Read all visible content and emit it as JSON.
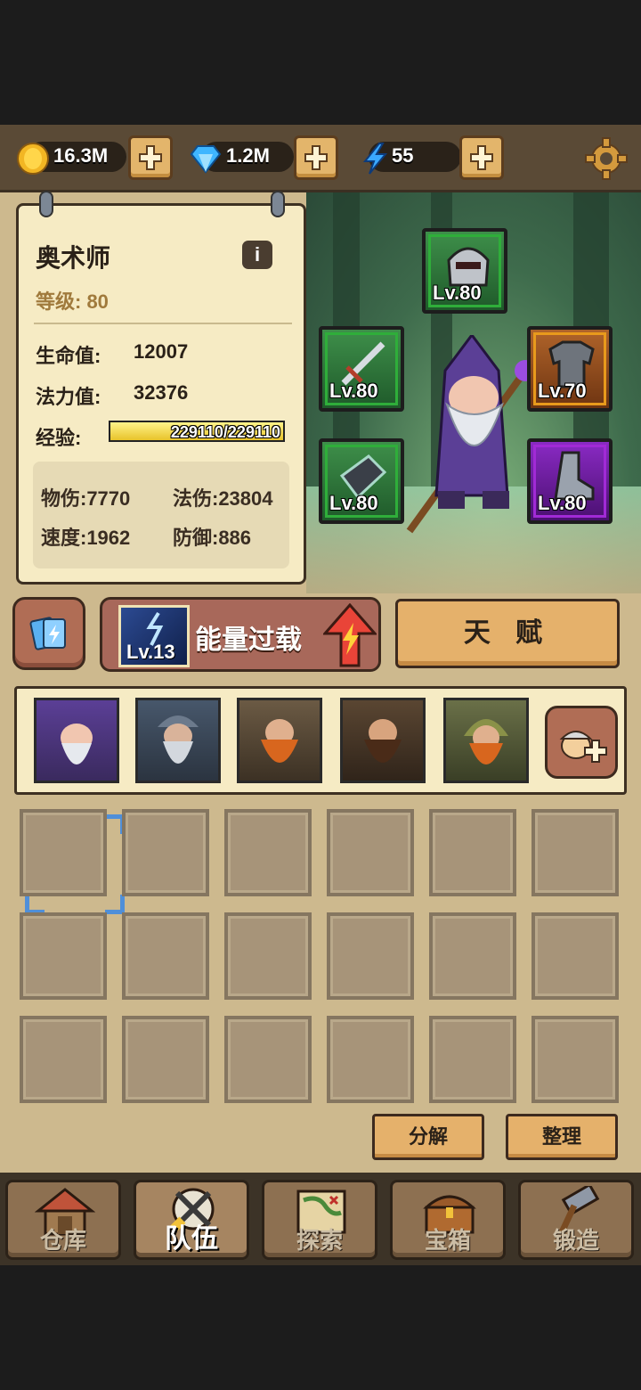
{
  "currencies": {
    "gold": "16.3M",
    "gems": "1.2M",
    "energy": "55"
  },
  "hero": {
    "name": "奥术师",
    "level_text": "等级: 80",
    "hp_label": "生命值:",
    "hp_value": "12007",
    "mp_label": "法力值:",
    "mp_value": "32376",
    "exp_label": "经验:",
    "exp_text": "229110/229110",
    "exp_fraction": 1.0,
    "phys_atk": "物伤:7770",
    "mag_atk": "法伤:23804",
    "speed": "速度:1962",
    "defense": "防御:886"
  },
  "equipment": {
    "helmet": "Lv.80",
    "weapon": "Lv.80",
    "armor": "Lv.70",
    "bracer": "Lv.80",
    "boots": "Lv.80"
  },
  "skill": {
    "level": "Lv.13",
    "name": "能量过载"
  },
  "talent_label": "天 赋",
  "actions": {
    "decompose": "分解",
    "sort": "整理"
  },
  "nav": {
    "warehouse": "仓库",
    "team": "队伍",
    "explore": "探索",
    "chest": "宝箱",
    "forge": "锻造"
  },
  "colors": {
    "slot_green": "#2fae3a",
    "slot_orange": "#e89a1c",
    "slot_purple": "#a12ad6",
    "select_blue": "#4f8fd9"
  }
}
